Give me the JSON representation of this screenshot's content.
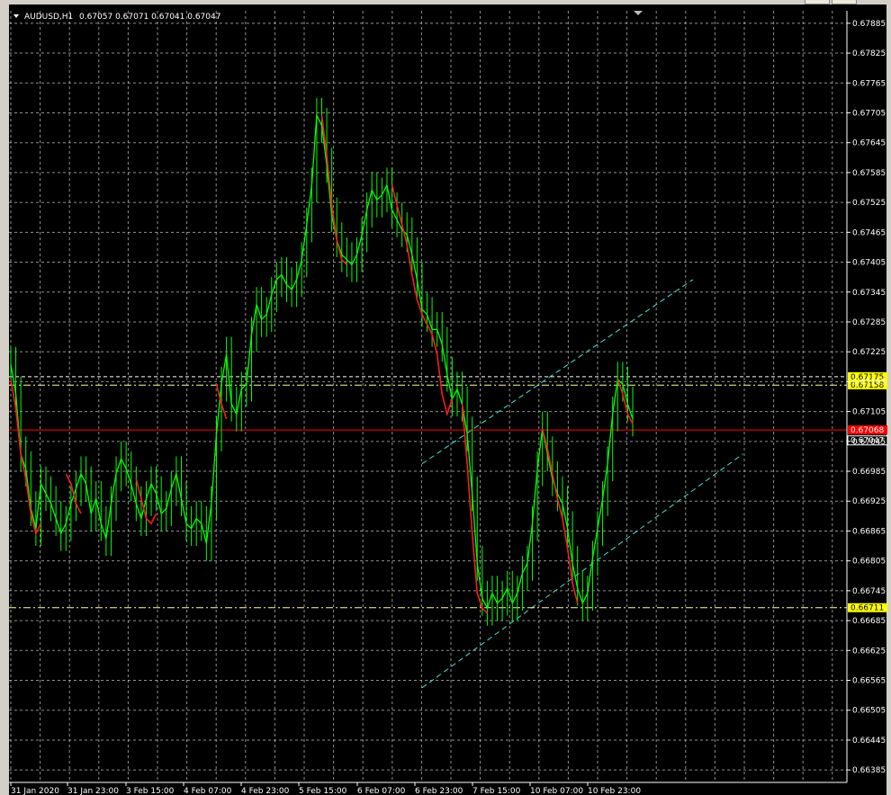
{
  "chart_data": {
    "type": "line",
    "symbol_label": "AUDUSD,H1",
    "ohlc_values": "0.67057 0.67071 0.67041 0.67047",
    "y_ticks": [
      "0.67885",
      "0.67825",
      "0.67765",
      "0.67705",
      "0.67645",
      "0.67585",
      "0.67525",
      "0.67465",
      "0.67405",
      "0.67345",
      "0.67285",
      "0.67225",
      "0.67165",
      "0.67105",
      "0.67045",
      "0.66985",
      "0.66925",
      "0.66865",
      "0.66805",
      "0.66745",
      "0.66685",
      "0.66625",
      "0.66565",
      "0.66505",
      "0.66445",
      "0.66385"
    ],
    "x_ticks": [
      "31 Jan 2020",
      "31 Jan 23:00",
      "3 Feb 15:00",
      "4 Feb 07:00",
      "4 Feb 23:00",
      "5 Feb 15:00",
      "6 Feb 07:00",
      "6 Feb 23:00",
      "7 Feb 15:00",
      "10 Feb 07:00",
      "10 Feb 23:00"
    ],
    "ylim": [
      0.6636,
      0.6791
    ],
    "grid": true,
    "series": [
      {
        "values": [
          0.672,
          0.6714,
          0.6702,
          0.6699,
          0.6691,
          0.6687,
          0.6696,
          0.6694,
          0.6692,
          0.6689,
          0.6686,
          0.6688,
          0.6692,
          0.6695,
          0.6698,
          0.6696,
          0.669,
          0.6693,
          0.6688,
          0.6685,
          0.6692,
          0.6698,
          0.6701,
          0.6699,
          0.6696,
          0.6692,
          0.6689,
          0.6693,
          0.6696,
          0.6694,
          0.669,
          0.6691,
          0.6695,
          0.6698,
          0.6693,
          0.6688,
          0.6687,
          0.6689,
          0.6688,
          0.6684,
          0.6692,
          0.6706,
          0.6716,
          0.6722,
          0.6712,
          0.671,
          0.6715,
          0.6716,
          0.6726,
          0.6732,
          0.6729,
          0.673,
          0.6734,
          0.6737,
          0.6738,
          0.6736,
          0.6735,
          0.6737,
          0.6741,
          0.6748,
          0.6756,
          0.677,
          0.6768,
          0.676,
          0.675,
          0.6745,
          0.6742,
          0.6741,
          0.674,
          0.6742,
          0.6746,
          0.6751,
          0.6755,
          0.6753,
          0.6754,
          0.6756,
          0.6751,
          0.6749,
          0.6747,
          0.6746,
          0.6742,
          0.6737,
          0.6731,
          0.673,
          0.6727,
          0.6727,
          0.6724,
          0.6718,
          0.6713,
          0.6715,
          0.6712,
          0.6706,
          0.6694,
          0.668,
          0.6673,
          0.6671,
          0.6674,
          0.6672,
          0.6673,
          0.6675,
          0.6672,
          0.6674,
          0.6678,
          0.668,
          0.6688,
          0.6699,
          0.6707,
          0.6702,
          0.6697,
          0.6694,
          0.6692,
          0.6687,
          0.668,
          0.6675,
          0.6672,
          0.6674,
          0.6681,
          0.6687,
          0.6693,
          0.67,
          0.671,
          0.6717,
          0.6716,
          0.6712,
          0.6709
        ],
        "color": "#00ff00"
      },
      {
        "segments": [
          {
            "from": 0,
            "values": [
              0.6717,
              0.6711,
              0.6702,
              0.6697,
              0.669,
              0.6686,
              0.6688
            ]
          },
          {
            "from": 11,
            "values": [
              0.6698,
              0.6696,
              0.6692,
              0.669
            ]
          },
          {
            "from": 25,
            "values": [
              0.6697,
              0.6693,
              0.6689,
              0.6688,
              0.669
            ]
          },
          {
            "from": 41,
            "values": [
              0.6716,
              0.6712,
              0.6709
            ]
          },
          {
            "from": 62,
            "values": [
              0.677,
              0.6762,
              0.6752,
              0.6745,
              0.6741,
              0.674
            ]
          },
          {
            "from": 76,
            "values": [
              0.6756,
              0.6752,
              0.6748,
              0.6744,
              0.6738,
              0.6733,
              0.673,
              0.6728,
              0.6726,
              0.6722,
              0.6714,
              0.671,
              0.6713
            ]
          },
          {
            "from": 90,
            "values": [
              0.6712,
              0.67,
              0.6686,
              0.6674,
              0.6671,
              0.667
            ]
          },
          {
            "from": 106,
            "values": [
              0.6707,
              0.6703,
              0.6698,
              0.6693,
              0.6689,
              0.6683,
              0.6676,
              0.6672
            ]
          },
          {
            "from": 121,
            "values": [
              0.6717,
              0.6714,
              0.671,
              0.6708
            ]
          }
        ],
        "color": "#ff1a1a"
      }
    ],
    "hlines": [
      {
        "value": 0.67175,
        "label": "0.67175",
        "style": "dash",
        "color": "#ffffff",
        "label_bg": "#ffff00"
      },
      {
        "value": 0.67158,
        "label": "0.67158",
        "style": "dashdot",
        "color": "#ffff99",
        "label_bg": "#ffff00"
      },
      {
        "value": 0.67068,
        "label": "0.67068",
        "style": "solid",
        "color": "#ff0000",
        "label_bg": "#ff0000"
      },
      {
        "value": 0.67047,
        "label": "0.67047",
        "style": "none",
        "color": "#ffffff",
        "label_bg": "#000000"
      },
      {
        "value": 0.66711,
        "label": "0.66711",
        "style": "dashdot",
        "color": "#ffff99",
        "label_bg": "#ffff00"
      }
    ],
    "channel": {
      "color": "#40e0d0",
      "upper": {
        "from": [
          82,
          0.67
        ],
        "to": [
          136,
          0.6737
        ]
      },
      "lower": {
        "from": [
          82,
          0.6655
        ],
        "to": [
          146,
          0.6702
        ]
      }
    }
  }
}
